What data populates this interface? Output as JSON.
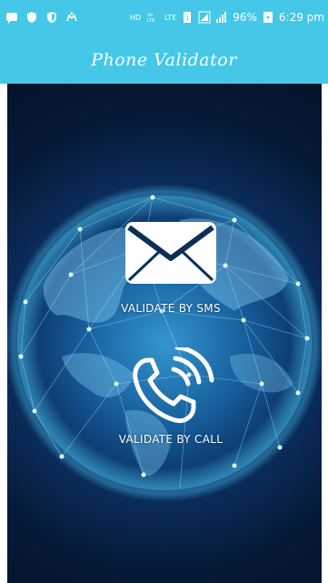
{
  "status_bar": {
    "network_speed": "",
    "signal_label": "LTE",
    "battery_percent": "96%",
    "time": "6:29 pm",
    "icons": [
      "message-icon",
      "shield-icon",
      "shield-icon",
      "robot-icon",
      "hd-icon",
      "volte-icon",
      "lte-icon",
      "sim-icon",
      "signal-icon",
      "battery-icon"
    ]
  },
  "app_bar": {
    "title": "Phone Validator",
    "background": "#45c8e8"
  },
  "actions": {
    "sms_label": "VALIDATE BY SMS",
    "call_label": "VALIDATE BY CALL"
  },
  "colors": {
    "accent": "#45c8e8",
    "background_dark": "#061a38",
    "globe_glow": "#2a7fb8"
  }
}
